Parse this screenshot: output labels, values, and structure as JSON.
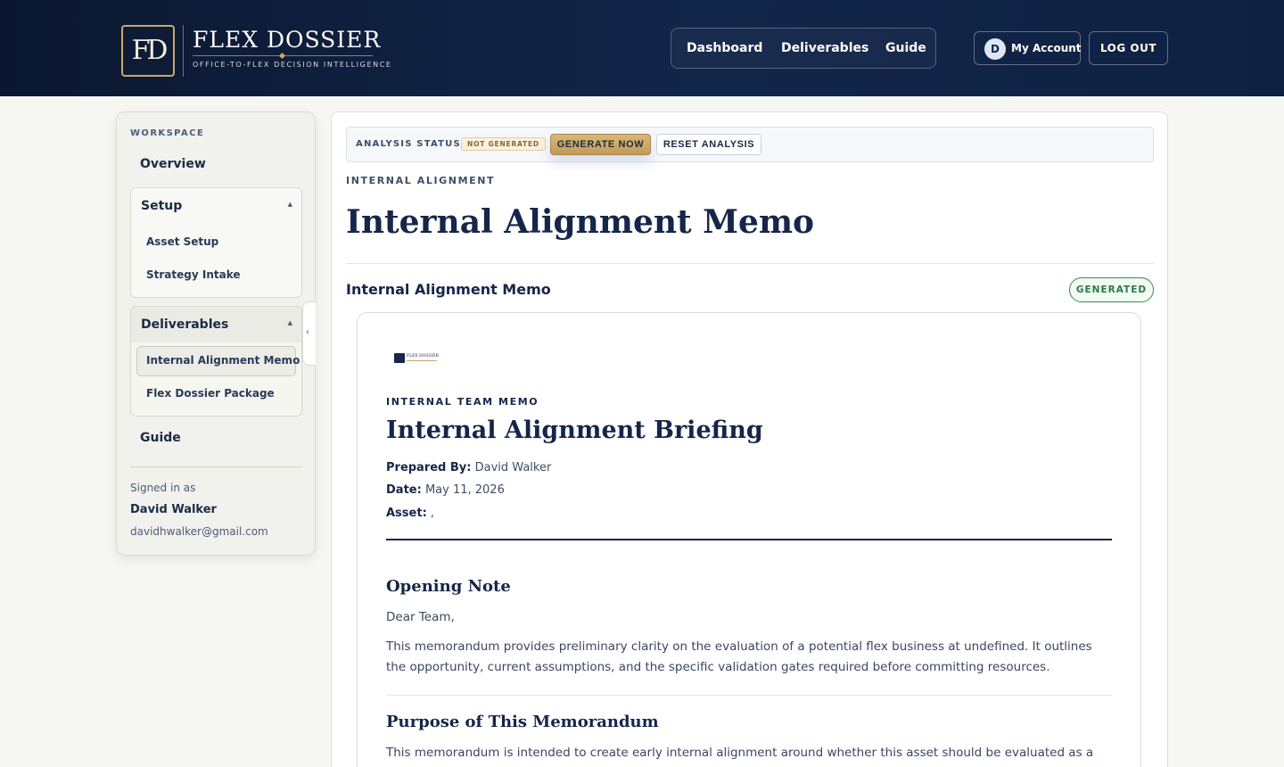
{
  "header": {
    "logo_mark": "FD",
    "brand_name": "FLEX DOSSIER",
    "brand_tagline": "OFFICE-TO-FLEX DECISION INTELLIGENCE",
    "nav": [
      "Dashboard",
      "Deliverables",
      "Guide"
    ],
    "account_initial": "D",
    "account_label": "My Account",
    "logout_label": "LOG OUT"
  },
  "sidebar": {
    "section_label": "WORKSPACE",
    "overview": "Overview",
    "setup": {
      "title": "Setup",
      "items": [
        "Asset Setup",
        "Strategy Intake"
      ]
    },
    "deliverables": {
      "title": "Deliverables",
      "items": [
        "Internal Alignment Memo",
        "Flex Dossier Package"
      ],
      "active_index": 0
    },
    "guide": "Guide",
    "signed_in_label": "Signed in as",
    "user_name": "David Walker",
    "user_email": "davidhwalker@gmail.com",
    "caret_icon": "caret-up-icon",
    "collapse_icon": "chevron-left-icon"
  },
  "main": {
    "analysis_status_label": "ANALYSIS STATUS",
    "status_badge": "NOT GENERATED",
    "generate_label": "GENERATE NOW",
    "reset_label": "RESET ANALYSIS",
    "eyebrow": "INTERNAL ALIGNMENT",
    "page_title": "Internal Alignment Memo",
    "section_title": "Internal Alignment Memo",
    "section_badge": "GENERATED"
  },
  "memo": {
    "logo_text": "FLEX DOSSIER",
    "eyebrow": "INTERNAL TEAM MEMO",
    "title": "Internal Alignment Briefing",
    "prepared_by_label": "Prepared By:",
    "prepared_by": "David Walker",
    "date_label": "Date:",
    "date": "May 11, 2026",
    "asset_label": "Asset:",
    "asset": ",",
    "opening_heading": "Opening Note",
    "salutation": "Dear Team,",
    "opening_body": "This memorandum provides preliminary clarity on the evaluation of a potential flex business at undefined. It outlines the opportunity, current assumptions, and the specific validation gates required before committing resources.",
    "purpose_heading": "Purpose of This Memorandum",
    "purpose_body": "This memorandum is intended to create early internal alignment around whether this asset should be evaluated as a"
  },
  "colors": {
    "navy": "#12264a",
    "gold": "#c9a86a",
    "success": "#2a7a45"
  }
}
